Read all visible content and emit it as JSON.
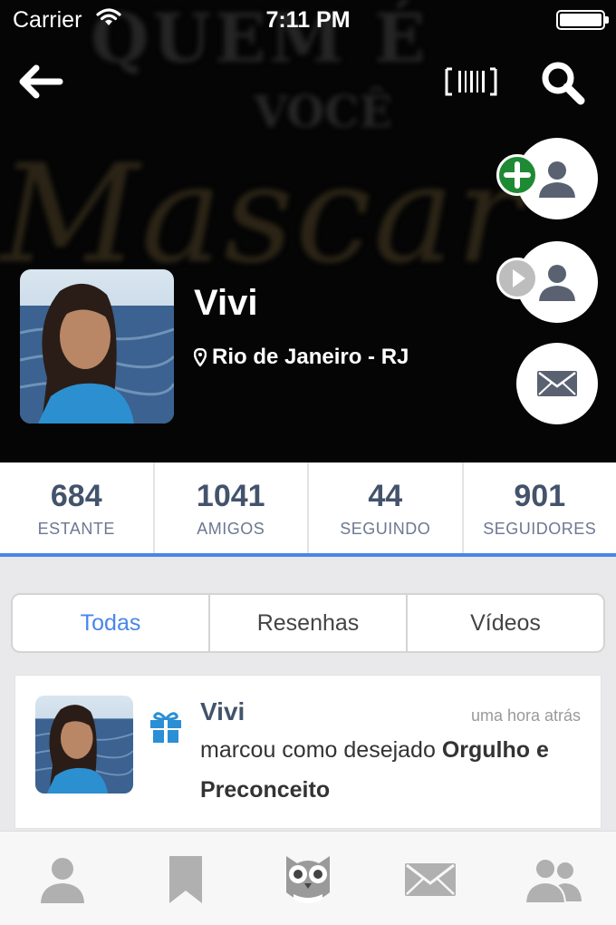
{
  "status_bar": {
    "carrier": "Carrier",
    "time": "7:11 PM"
  },
  "background_text": {
    "line1": "QUEM É",
    "line2": "VOCÊ",
    "line3": "Mascar"
  },
  "profile": {
    "name": "Vivi",
    "location": "Rio de Janeiro - RJ"
  },
  "stats": [
    {
      "value": "684",
      "label": "ESTANTE"
    },
    {
      "value": "1041",
      "label": "AMIGOS"
    },
    {
      "value": "44",
      "label": "SEGUINDO"
    },
    {
      "value": "901",
      "label": "SEGUIDORES"
    }
  ],
  "tabs": [
    {
      "label": "Todas",
      "active": true
    },
    {
      "label": "Resenhas",
      "active": false
    },
    {
      "label": "Vídeos",
      "active": false
    }
  ],
  "feed": [
    {
      "user": "Vivi",
      "time": "uma hora atrás",
      "action": "marcou como desejado",
      "book": "Orgulho e Preconceito",
      "icon": "gift-icon"
    }
  ],
  "colors": {
    "accent": "#4a86e8",
    "stat_text": "#43536c",
    "add_badge": "#1f8a34",
    "header_bg": "#050505"
  },
  "tabbar": [
    {
      "icon": "profile-icon"
    },
    {
      "icon": "bookmark-icon"
    },
    {
      "icon": "owl-icon"
    },
    {
      "icon": "mail-icon"
    },
    {
      "icon": "friends-icon"
    }
  ]
}
